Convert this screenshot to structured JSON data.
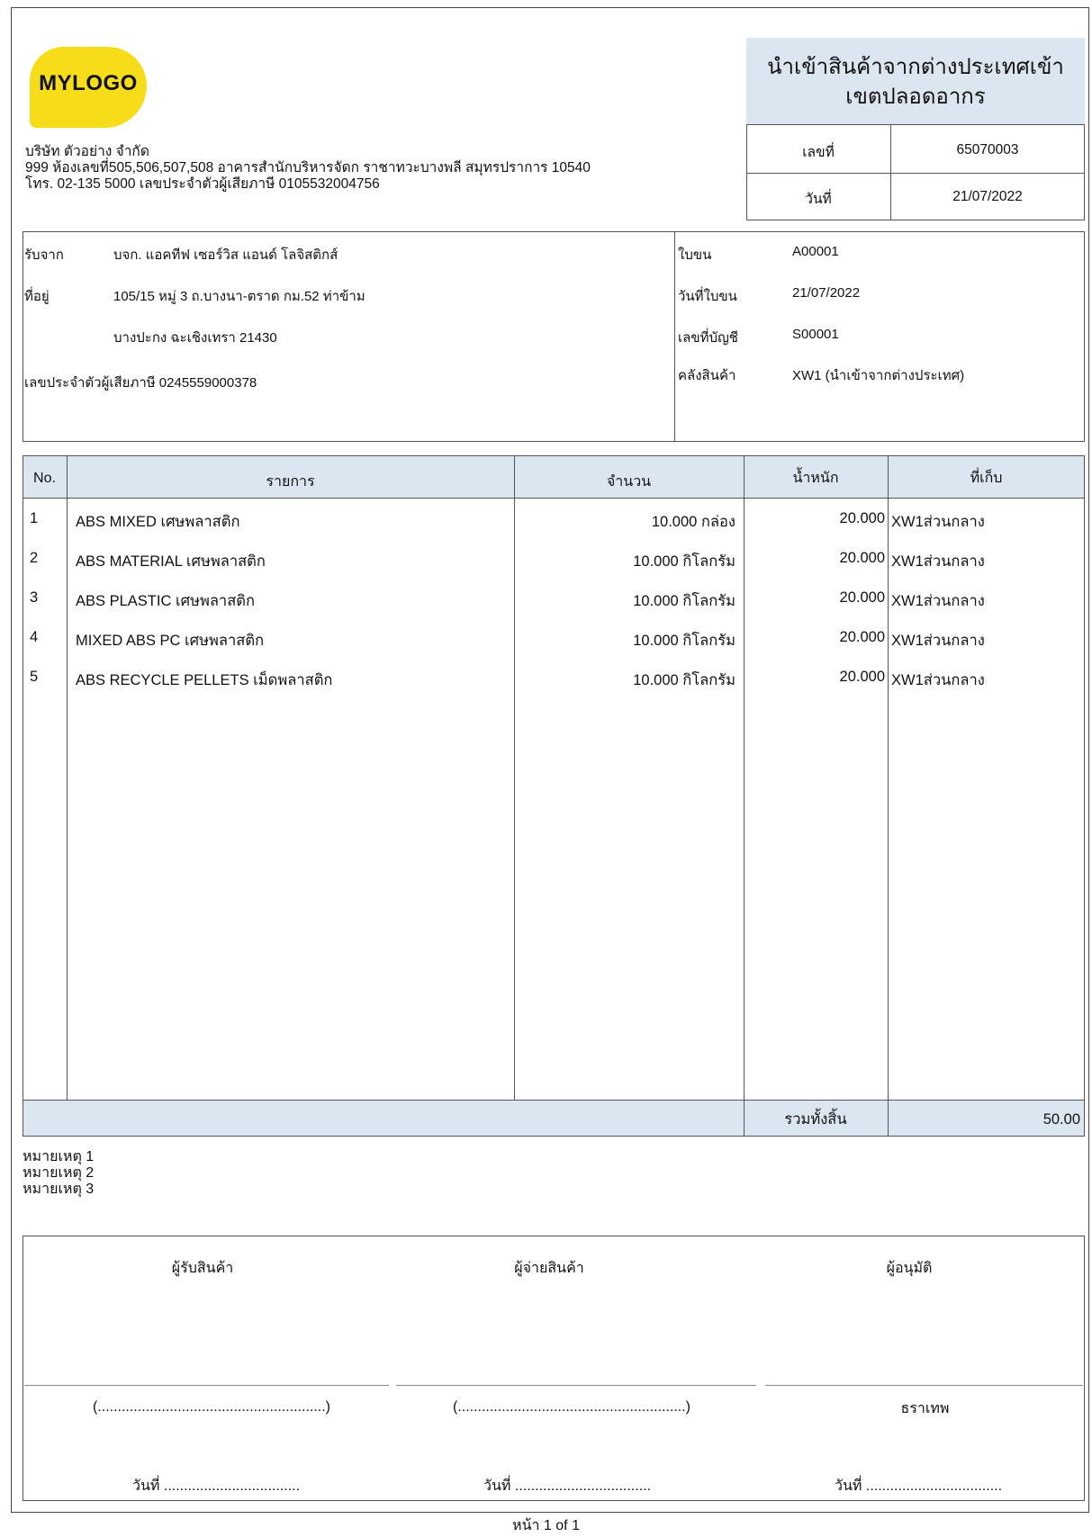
{
  "logo": {
    "text": "MYLOGO"
  },
  "company": {
    "name": "บริษัท ตัวอย่าง จำกัด",
    "address": "999 ห้องเลขที่505,506,507,508 อาคารสำนักบริหารจัดก ราชาทวะบางพลี สมุทรปราการ 10540",
    "contact": "โทร. 02-135 5000 เลขประจำตัวผู้เสียภาษี 0105532004756"
  },
  "doc": {
    "title_line1": "นำเข้าสินค้าจากต่างประเทศเข้า",
    "title_line2": "เขตปลอดอากร",
    "number_label": "เลขที่",
    "number": "65070003",
    "date_label": "วันที่",
    "date": "21/07/2022"
  },
  "receiver": {
    "from_label": "รับจาก",
    "from": "บจก. แอคทีฟ เซอร์วิส แอนด์ โลจิสติกส์",
    "address_label": "ที่อยู่",
    "address1": "105/15 หมู่ 3 ถ.บางนา-ตราด กม.52 ท่าข้าม",
    "address2": "บางปะกง ฉะเชิงเทรา 21430",
    "tax_id": "เลขประจำตัวผู้เสียภาษี 0245559000378"
  },
  "shipment": {
    "waybill_label": "ใบขน",
    "waybill": "A00001",
    "waybill_date_label": "วันที่ใบขน",
    "waybill_date": "21/07/2022",
    "account_label": "เลขที่บัญชี",
    "account": "S00001",
    "warehouse_label": "คลังสินค้า",
    "warehouse": "XW1 (นำเข้าจากต่างประเทศ)"
  },
  "table": {
    "headers": {
      "no": "No.",
      "item": "รายการ",
      "qty": "จำนวน",
      "weight": "น้ำหนัก",
      "location": "ที่เก็บ"
    },
    "rows": [
      {
        "no": "1",
        "item": "ABS MIXED เศษพลาสติก",
        "qty": "10.000 กล่อง",
        "weight": "20.000",
        "location": "XW1ส่วนกลาง"
      },
      {
        "no": "2",
        "item": "ABS MATERIAL เศษพลาสติก",
        "qty": "10.000 กิโลกรัม",
        "weight": "20.000",
        "location": "XW1ส่วนกลาง"
      },
      {
        "no": "3",
        "item": "ABS PLASTIC เศษพลาสติก",
        "qty": "10.000 กิโลกรัม",
        "weight": "20.000",
        "location": "XW1ส่วนกลาง"
      },
      {
        "no": "4",
        "item": "MIXED ABS PC เศษพลาสติก",
        "qty": "10.000 กิโลกรัม",
        "weight": "20.000",
        "location": "XW1ส่วนกลาง"
      },
      {
        "no": "5",
        "item": "ABS RECYCLE PELLETS เม็ดพลาสติก",
        "qty": "10.000 กิโลกรัม",
        "weight": "20.000",
        "location": "XW1ส่วนกลาง"
      }
    ],
    "total_label": "รวมทั้งสิ้น",
    "total": "50.00"
  },
  "notes": [
    "หมายเหตุ 1",
    "หมายเหตุ 2",
    "หมายเหตุ 3"
  ],
  "signatures": {
    "receiver": "ผู้รับสินค้า",
    "issuer": "ผู้จ่ายสินค้า",
    "approver": "ผู้อนุมัติ",
    "name_placeholder": "(.........................................................)",
    "approver_name": "ธราเทพ",
    "date_line": "วันที่ .................................."
  },
  "footer": {
    "page": "หน้า 1 of 1"
  },
  "colors": {
    "header_fill": "#dce6f1",
    "logo_yellow": "#f7dc19"
  }
}
